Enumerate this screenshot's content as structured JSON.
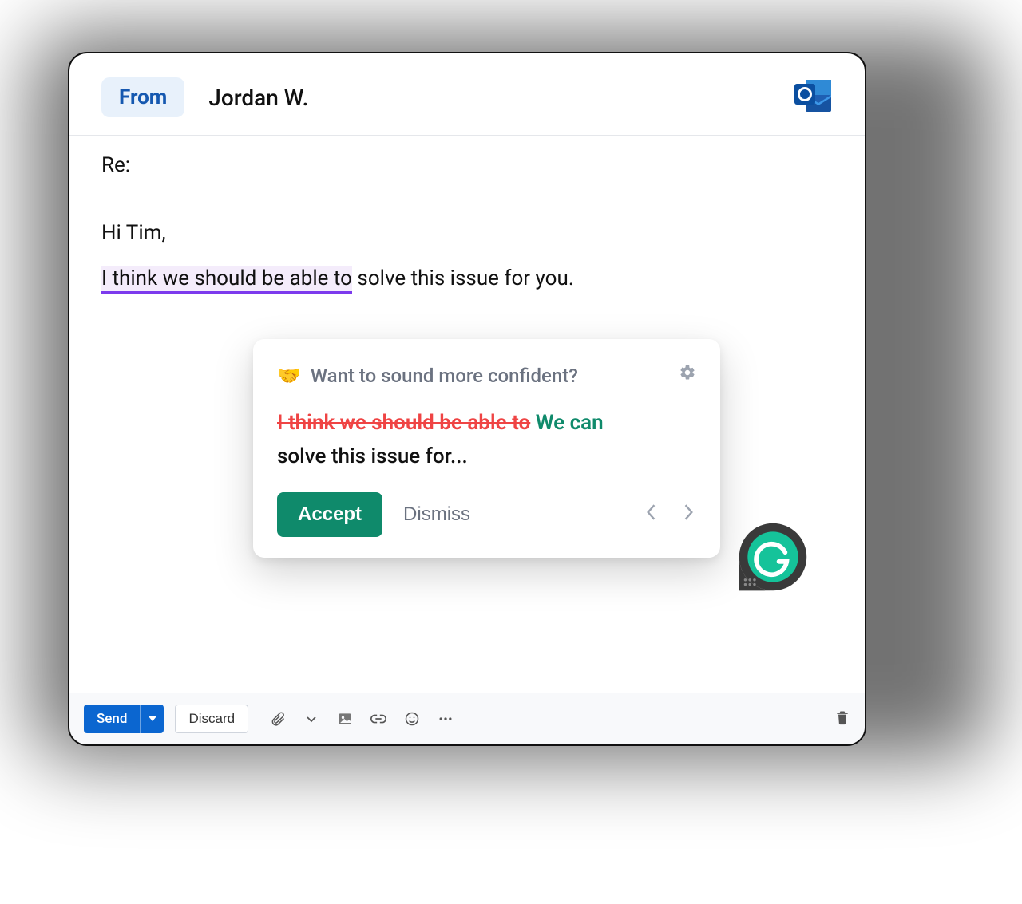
{
  "header": {
    "from_label": "From",
    "sender": "Jordan W."
  },
  "subject": "Re:",
  "body": {
    "greeting": "Hi Tim,",
    "highlighted": "I think we should be able to",
    "rest": " solve this issue for you."
  },
  "popup": {
    "emoji": "🤝",
    "title": "Want to sound more confident?",
    "strike": "I think we should be able to",
    "replacement": "We can",
    "rest": "solve this issue for...",
    "accept": "Accept",
    "dismiss": "Dismiss"
  },
  "footer": {
    "send": "Send",
    "discard": "Discard"
  }
}
